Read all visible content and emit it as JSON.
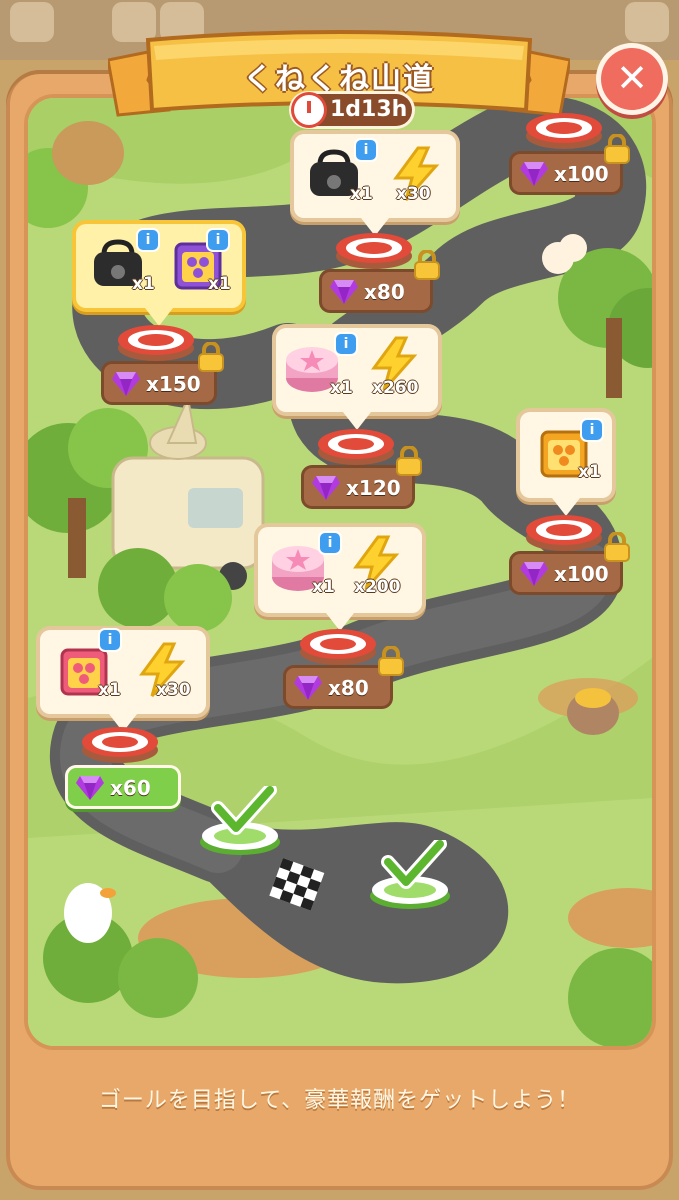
{
  "header": {
    "title": "くねくね山道",
    "timer": "1d13h"
  },
  "footer": {
    "text": "ゴールを目指して、豪華報酬をゲットしよう！"
  },
  "icons": {
    "close": "close-icon",
    "clock": "clock-icon",
    "lock": "lock-icon",
    "gem": "gem-icon",
    "info": "info-icon",
    "check": "checkmark-icon"
  },
  "colors": {
    "panel": "#e8a869",
    "grass": "#b9d978",
    "road": "#6b6b6b",
    "gem": "#b23be0",
    "energy": "#ffd12e"
  },
  "stages": [
    {
      "status": "completed",
      "reward": "checkmark"
    },
    {
      "status": "completed",
      "reward": "checkmark"
    },
    {
      "status": "claimable",
      "items": [
        {
          "icon": "pink-card-pack-icon",
          "qty": "x1"
        },
        {
          "icon": "energy-bolt-icon",
          "qty": "x30"
        }
      ],
      "gems": "x60"
    },
    {
      "status": "locked",
      "items": [
        {
          "icon": "pink-gift-box-icon",
          "qty": "x1"
        },
        {
          "icon": "energy-bolt-icon",
          "qty": "x200"
        }
      ],
      "gems": "x80"
    },
    {
      "status": "locked",
      "items": [
        {
          "icon": "gold-card-pack-icon",
          "qty": "x1"
        }
      ],
      "gems": "x100"
    },
    {
      "status": "locked",
      "items": [
        {
          "icon": "pink-gift-box-icon",
          "qty": "x1"
        },
        {
          "icon": "energy-bolt-icon",
          "qty": "x260"
        }
      ],
      "gems": "x120"
    },
    {
      "status": "locked",
      "items": [
        {
          "icon": "black-bag-icon",
          "qty": "x1"
        },
        {
          "icon": "purple-card-pack-icon",
          "qty": "x1"
        }
      ],
      "gems": "x150"
    },
    {
      "status": "locked",
      "items": [
        {
          "icon": "black-bag-icon",
          "qty": "x1"
        },
        {
          "icon": "energy-bolt-icon",
          "qty": "x30"
        }
      ],
      "gems": "x80"
    },
    {
      "status": "locked",
      "items": [],
      "gems": "x100"
    }
  ]
}
